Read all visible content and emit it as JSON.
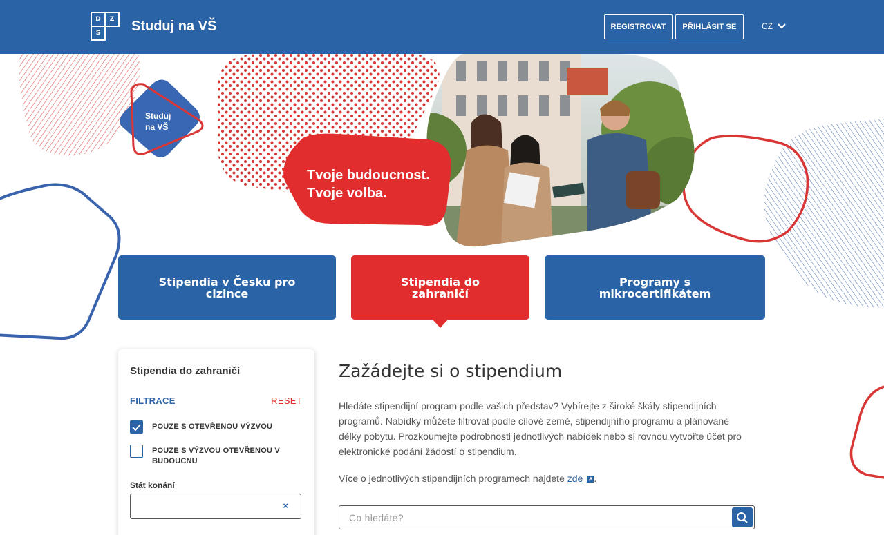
{
  "header": {
    "logo_letters": [
      "D",
      "Z",
      "S"
    ],
    "site_title": "Studuj na VŠ",
    "register_label": "REGISTROVAT",
    "login_label": "PŘIHLÁSIT SE",
    "language": "CZ"
  },
  "hero": {
    "line1": "Tvoje budoucnost.",
    "line2": "Tvoje volba.",
    "badge_line1": "Studuj",
    "badge_line2": "na VŠ"
  },
  "tabs": [
    {
      "label": "Stipendia v Česku pro cizince",
      "active": false
    },
    {
      "label": "Stipendia do zahraničí",
      "active": true
    },
    {
      "label": "Programy s mikrocertifikátem",
      "active": false
    }
  ],
  "filter_panel": {
    "title": "Stipendia do zahraničí",
    "filter_label": "FILTRACE",
    "reset_label": "RESET",
    "checkboxes": [
      {
        "label": "POUZE S OTEVŘENOU VÝZVOU",
        "checked": true
      },
      {
        "label": "POUZE S VÝZVOU OTEVŘENOU V BUDOUCNU",
        "checked": false
      }
    ],
    "state_label": "Stát konání",
    "state_value": "",
    "clear_symbol": "×"
  },
  "main": {
    "title": "Zažádejte si o stipendium",
    "description": "Hledáte stipendijní program podle vašich představ? Vybírejte z široké škály stipendijních programů. Nabídky můžete filtrovat podle cílové země, stipendijního programu a plánované délky pobytu. Prozkoumejte podrobnosti jednotlivých nabídek nebo si rovnou vytvořte účet pro elektronické podání žádostí o stipendium.",
    "more_text": "Více o jednotlivých stipendijních programech najdete ",
    "more_link": "zde",
    "more_end": ".",
    "search_placeholder": "Co hledáte?"
  },
  "colors": {
    "primary_blue": "#2a63a6",
    "accent_red": "#e12d2d"
  },
  "icons": [
    "chevron-down-icon",
    "external-link-icon",
    "search-icon",
    "checkmark-icon",
    "clear-icon"
  ]
}
